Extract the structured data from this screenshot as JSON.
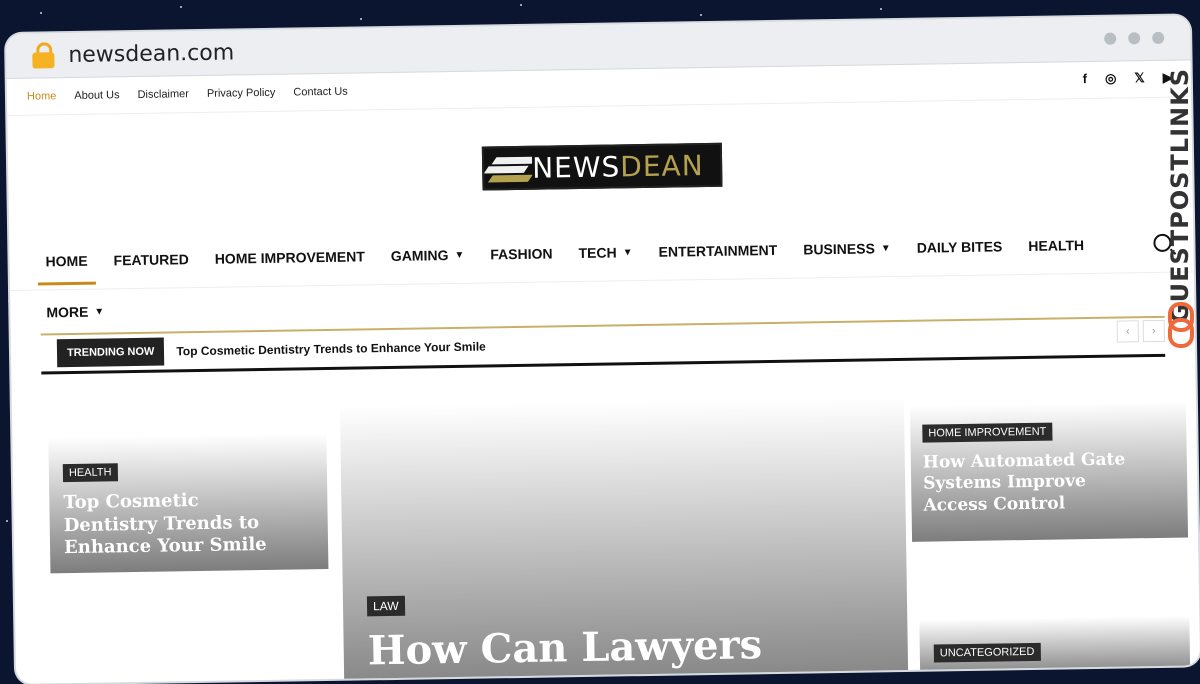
{
  "browser": {
    "domain": "newsdean.com"
  },
  "top_nav": {
    "items": [
      "Home",
      "About Us",
      "Disclaimer",
      "Privacy Policy",
      "Contact Us"
    ]
  },
  "social": {
    "icons": [
      "facebook-icon",
      "instagram-icon",
      "x-icon",
      "youtube-icon"
    ],
    "glyphs": [
      "f",
      "◎",
      "𝕏",
      "▶"
    ]
  },
  "logo": {
    "white": "NEWS",
    "gold": "DEAN"
  },
  "main_nav": {
    "row1": [
      {
        "label": "HOME",
        "dropdown": false
      },
      {
        "label": "FEATURED",
        "dropdown": false
      },
      {
        "label": "HOME IMPROVEMENT",
        "dropdown": false
      },
      {
        "label": "GAMING",
        "dropdown": true
      },
      {
        "label": "FASHION",
        "dropdown": false
      },
      {
        "label": "TECH",
        "dropdown": true
      },
      {
        "label": "ENTERTAINMENT",
        "dropdown": false
      },
      {
        "label": "BUSINESS",
        "dropdown": true
      },
      {
        "label": "DAILY BITES",
        "dropdown": false
      },
      {
        "label": "HEALTH",
        "dropdown": false
      }
    ],
    "row2": [
      {
        "label": "MORE",
        "dropdown": true
      }
    ]
  },
  "trending": {
    "label": "TRENDING NOW",
    "headline": "Top Cosmetic Dentistry Trends to Enhance Your Smile",
    "prev": "‹",
    "next": "›"
  },
  "cards": {
    "left": {
      "category": "HEALTH",
      "title": "Top Cosmetic Dentistry Trends to Enhance Your Smile"
    },
    "center": {
      "category": "LAW",
      "title": "How Can Lawyers"
    },
    "right_top": {
      "category": "HOME IMPROVEMENT",
      "title": "How Automated Gate Systems Improve Access Control"
    },
    "right_bottom": {
      "category": "UNCATEGORIZED"
    }
  },
  "watermark": {
    "text": "GUESTPOSTLINKS"
  },
  "colors": {
    "accent": "#c88b1b",
    "logo_gold": "#b4a14e",
    "background": "#0b1530"
  }
}
